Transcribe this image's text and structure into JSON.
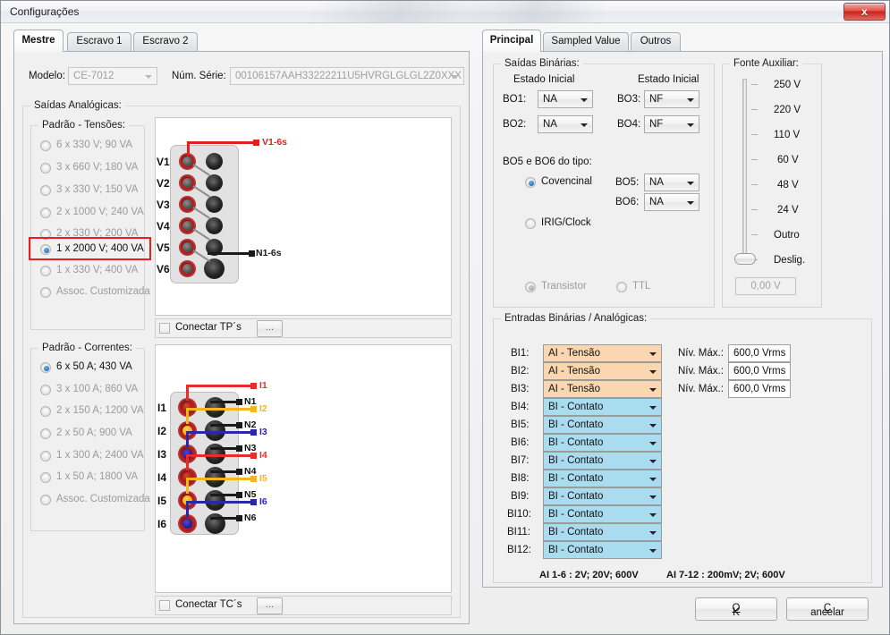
{
  "window": {
    "title": "Configurações",
    "close_icon": "close-icon",
    "close_glyph": "x"
  },
  "main_tabs": [
    {
      "label": "Mestre",
      "active": true
    },
    {
      "label": "Escravo 1",
      "active": false
    },
    {
      "label": "Escravo 2",
      "active": false
    }
  ],
  "device": {
    "model_label": "Modelo:",
    "model_value": "CE-7012",
    "serial_label": "Núm. Série:",
    "serial_value": "00106157AAH33222211U5HVRGLGLGL2Z0XXX"
  },
  "analog_outputs": {
    "group_label": "Saídas Analógicas:",
    "voltage": {
      "group_label": "Padrão - Tensões:",
      "selected_index": 5,
      "options": [
        "6 x 330 V; 90 VA",
        "3 x 660 V; 180 VA",
        "3 x 330 V; 150 VA",
        "2 x 1000 V; 240 VA",
        "2 x 330 V; 200 VA",
        "1 x 2000 V; 400 VA",
        "1 x 330 V; 400 VA",
        "Assoc. Customizada"
      ],
      "highlight_color": "#e8201c"
    },
    "current": {
      "group_label": "Padrão - Correntes:",
      "selected_index": 0,
      "options": [
        "6 x 50 A; 430 VA",
        "3 x 100 A; 860 VA",
        "2 x 150 A; 1200 VA",
        "2 x 50 A; 900 VA",
        "1 x 300 A; 2400 VA",
        "1 x 50 A; 1800 VA",
        "Assoc. Customizada"
      ]
    },
    "connect_tp": {
      "label": "Conectar TP´s",
      "checked": false,
      "more_label": "..."
    },
    "connect_tc": {
      "label": "Conectar TC´s",
      "checked": false,
      "more_label": "..."
    }
  },
  "voltage_diagram": {
    "terminals": [
      "V1",
      "V2",
      "V3",
      "V4",
      "V5",
      "V6"
    ],
    "output_label": "V1-6s",
    "neutral_label": "N1-6s"
  },
  "current_diagram": {
    "terminals": [
      "I1",
      "I2",
      "I3",
      "I4",
      "I5",
      "I6"
    ],
    "neutrals": [
      "N1",
      "N2",
      "N3",
      "N4",
      "N5",
      "N6"
    ],
    "phase_labels": [
      "I1",
      "I2",
      "I3",
      "I4",
      "I5",
      "I6"
    ],
    "phase_colors": [
      "#e62d2d",
      "#f2b71b",
      "#2a27a8",
      "#e62d2d",
      "#f2b71b",
      "#2a27a8"
    ]
  },
  "right_tabs": [
    {
      "label": "Principal",
      "active": true
    },
    {
      "label": "Sampled Value",
      "active": false
    },
    {
      "label": "Outros",
      "active": false
    }
  ],
  "binary_outputs": {
    "group_label": "Saídas Binárias:",
    "col_header_left": "Estado Inicial",
    "col_header_right": "Estado Inicial",
    "left": [
      {
        "label": "BO1:",
        "value": "NA"
      },
      {
        "label": "BO2:",
        "value": "NA"
      }
    ],
    "right": [
      {
        "label": "BO3:",
        "value": "NF"
      },
      {
        "label": "BO4:",
        "value": "NF"
      }
    ],
    "type_label": "BO5 e BO6 do tipo:",
    "type_options": [
      {
        "label": "Covencinal",
        "selected": true,
        "disabled": false
      },
      {
        "label": "IRIG/Clock",
        "selected": false,
        "disabled": false
      }
    ],
    "bo56": [
      {
        "label": "BO5:",
        "value": "NA"
      },
      {
        "label": "BO6:",
        "value": "NA"
      }
    ],
    "sub_options": [
      {
        "label": "Transistor",
        "selected": true,
        "disabled": true
      },
      {
        "label": "TTL",
        "selected": false,
        "disabled": true
      }
    ]
  },
  "aux_source": {
    "group_label": "Fonte Auxiliar:",
    "steps": [
      "250 V",
      "220 V",
      "110 V",
      "60 V",
      "48 V",
      "24 V",
      "Outro",
      "Deslig."
    ],
    "selected_index": 7,
    "value": "0,00 V"
  },
  "binary_inputs": {
    "group_label": "Entradas Binárias / Analógicas:",
    "level_label": "Nív. Máx.:",
    "rows": [
      {
        "label": "BI1:",
        "type": "AI - Tensão",
        "kind": "ai",
        "level": "600,0 Vrms"
      },
      {
        "label": "BI2:",
        "type": "AI - Tensão",
        "kind": "ai",
        "level": "600,0 Vrms"
      },
      {
        "label": "BI3:",
        "type": "AI - Tensão",
        "kind": "ai",
        "level": "600,0 Vrms"
      },
      {
        "label": "BI4:",
        "type": "BI - Contato",
        "kind": "bi",
        "level": ""
      },
      {
        "label": "BI5:",
        "type": "BI - Contato",
        "kind": "bi",
        "level": ""
      },
      {
        "label": "BI6:",
        "type": "BI - Contato",
        "kind": "bi",
        "level": ""
      },
      {
        "label": "BI7:",
        "type": "BI - Contato",
        "kind": "bi",
        "level": ""
      },
      {
        "label": "BI8:",
        "type": "BI - Contato",
        "kind": "bi",
        "level": ""
      },
      {
        "label": "BI9:",
        "type": "BI - Contato",
        "kind": "bi",
        "level": ""
      },
      {
        "label": "BI10:",
        "type": "BI - Contato",
        "kind": "bi",
        "level": ""
      },
      {
        "label": "BI11:",
        "type": "BI - Contato",
        "kind": "bi",
        "level": ""
      },
      {
        "label": "BI12:",
        "type": "BI - Contato",
        "kind": "bi",
        "level": ""
      }
    ],
    "note_left": "AI 1-6 : 2V; 20V; 600V",
    "note_right": "AI 7-12 : 200mV; 2V; 600V"
  },
  "footer": {
    "ok_label": "OK",
    "ok_accel": "O",
    "cancel_label": "Cancelar",
    "cancel_accel": "C"
  }
}
